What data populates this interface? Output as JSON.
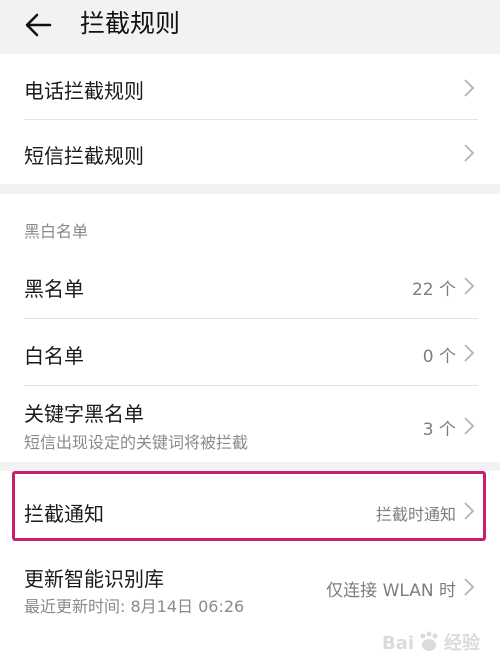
{
  "header": {
    "title": "拦截规则",
    "back_icon": "arrow-left-icon"
  },
  "rules": {
    "items": [
      {
        "label": "电话拦截规则"
      },
      {
        "label": "短信拦截规则"
      }
    ]
  },
  "lists": {
    "section_title": "黑白名单",
    "items": [
      {
        "label": "黑名单",
        "value": "22 个"
      },
      {
        "label": "白名单",
        "value": "0 个"
      },
      {
        "label": "关键字黑名单",
        "sub": "短信出现设定的关键词将被拦截",
        "value": "3 个"
      }
    ]
  },
  "notify": {
    "label": "拦截通知",
    "value": "拦截时通知"
  },
  "update": {
    "label": "更新智能识别库",
    "sub": "最近更新时间: 8月14日 06:26",
    "value": "仅连接 WLAN 时"
  },
  "highlight_color": "#c81f6a",
  "watermark": {
    "brand": "Bai",
    "suffix": "经验"
  }
}
